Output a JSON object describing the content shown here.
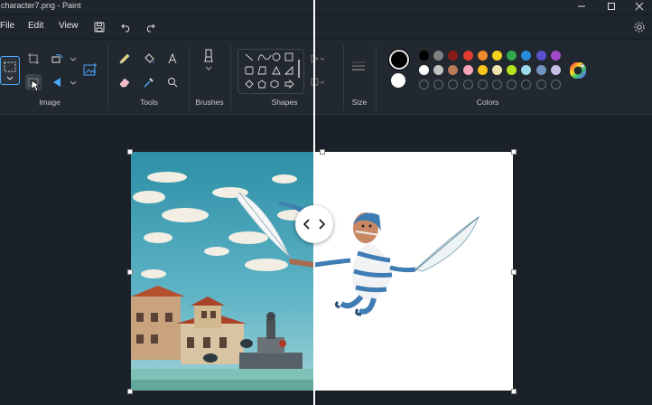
{
  "window": {
    "title": "character7.png - Paint"
  },
  "menu": {
    "file": "File",
    "edit": "Edit",
    "view": "View"
  },
  "ribbon": {
    "groups": {
      "image": "Image",
      "tools": "Tools",
      "brushes": "Brushes",
      "shapes": "Shapes",
      "size": "Size",
      "colors": "Colors"
    }
  },
  "colors": {
    "accent": "#4aa8ff",
    "primary": "#000000",
    "secondary": "#ffffff",
    "palette_row1": [
      "#000000",
      "#7f7f7f",
      "#8b1a1a",
      "#e03c31",
      "#ef8a2c",
      "#f5d21b",
      "#2fa84f",
      "#2a8bd8",
      "#5a4fcf",
      "#a24ac9"
    ],
    "palette_row2": [
      "#ffffff",
      "#c3c3c3",
      "#b97a57",
      "#f4a6b8",
      "#f9c31b",
      "#efe4b0",
      "#b5e61d",
      "#99d9ea",
      "#7092be",
      "#c8bfe7"
    ]
  },
  "icons": [
    "select-icon",
    "crop-icon",
    "rotate-icon",
    "resize-icon",
    "remove-background-icon",
    "flip-icon",
    "image-generator-icon",
    "pencil-icon",
    "fill-icon",
    "text-icon",
    "eraser-icon",
    "color-picker-icon",
    "magnifier-icon",
    "brush-icon",
    "size-icon",
    "edit-colors-icon",
    "save-icon",
    "undo-icon",
    "redo-icon",
    "settings-icon",
    "minimize-icon",
    "maximize-icon",
    "close-icon"
  ]
}
